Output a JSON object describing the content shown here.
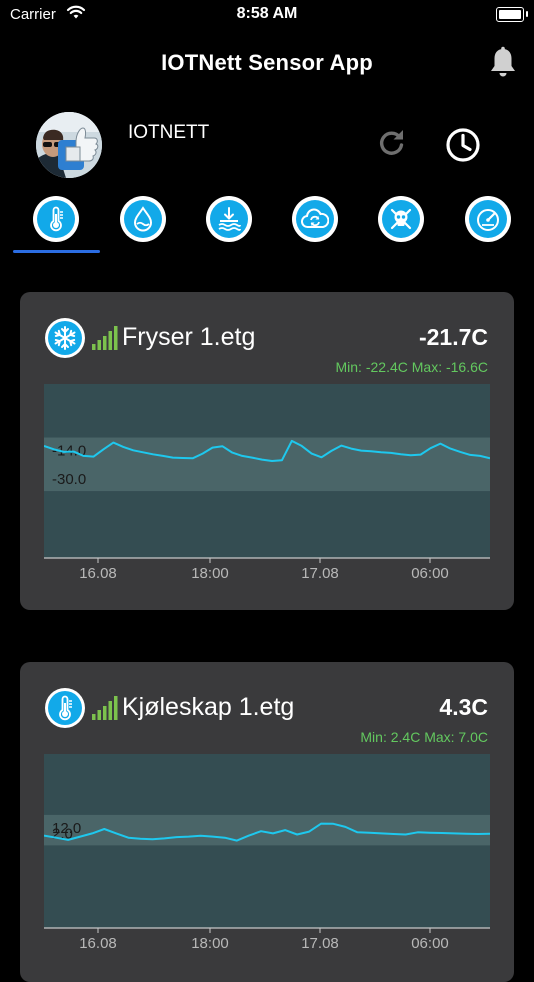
{
  "status_bar": {
    "carrier": "Carrier",
    "time": "8:58 AM"
  },
  "header": {
    "title": "IOTNett Sensor App",
    "bell_icon": "bell-icon"
  },
  "user": {
    "name": "IOTNETT",
    "refresh_icon": "refresh-icon",
    "clock_icon": "clock-icon"
  },
  "tabs": [
    {
      "icon": "thermometer-icon",
      "selected": true
    },
    {
      "icon": "humidity-drop-icon",
      "selected": false
    },
    {
      "icon": "water-level-icon",
      "selected": false
    },
    {
      "icon": "cloud-sync-icon",
      "selected": false
    },
    {
      "icon": "skull-crossbones-icon",
      "selected": false
    },
    {
      "icon": "gauge-icon",
      "selected": false
    }
  ],
  "colors": {
    "accent": "#12a9e9",
    "tab_underline": "#2b6de3",
    "minmax": "#63c85f",
    "card_bg": "#3a3a3c",
    "chart_bg": "#344d52",
    "band": "#4a6568",
    "line": "#1ec8ee"
  },
  "sensors": [
    {
      "icon": "snowflake-icon",
      "name": "Fryser 1.etg",
      "value": "-21.7C",
      "minmax": "Min: -22.4C Max: -16.6C"
    },
    {
      "icon": "thermometer-icon",
      "name": "Kjøleskap 1.etg",
      "value": "4.3C",
      "minmax": "Min: 2.4C Max: 7.0C"
    }
  ],
  "chart_data": [
    {
      "type": "line",
      "title": "",
      "threshold_labels": [
        "-14.0",
        "-30.0"
      ],
      "band": [
        -30.0,
        -14.0
      ],
      "ylim": [
        -50,
        2
      ],
      "x_ticks": [
        "16.08",
        "18:00",
        "17.08",
        "06:00"
      ],
      "series": [
        {
          "values": [
            -16.5,
            -17.5,
            -18.3,
            -18.2,
            -19.5,
            -19.7,
            -17.5,
            -15.5,
            -16.8,
            -17.8,
            -18.4,
            -19.0,
            -19.5,
            -20.0,
            -20.1,
            -20.2,
            -18.8,
            -17.0,
            -16.6,
            -18.5,
            -19.5,
            -20.0,
            -20.6,
            -21.0,
            -20.8,
            -15.0,
            -16.5,
            -18.8,
            -19.9,
            -18.0,
            -16.4,
            -17.3,
            -17.9,
            -18.1,
            -18.4,
            -18.6,
            -19.0,
            -19.3,
            -19.1,
            -17.2,
            -15.8,
            -17.3,
            -18.3,
            -19.2,
            -19.5,
            -20.2
          ]
        }
      ]
    },
    {
      "type": "line",
      "title": "",
      "threshold_labels": [
        "12.0",
        "2.0"
      ],
      "band": [
        -2.0,
        12.0
      ],
      "ylim": [
        -40,
        40
      ],
      "x_ticks": [
        "16.08",
        "18:00",
        "17.08",
        "06:00"
      ],
      "series": [
        {
          "values": [
            2.5,
            1.5,
            0.5,
            2.0,
            3.5,
            5.5,
            3.5,
            1.5,
            1.0,
            0.8,
            1.2,
            1.8,
            2.0,
            2.4,
            2.0,
            1.5,
            0.2,
            2.5,
            4.5,
            3.5,
            5.0,
            3.0,
            4.3,
            8.0,
            7.9,
            6.5,
            4.0,
            3.8,
            3.5,
            3.2,
            3.0,
            4.0,
            3.8,
            3.7,
            3.5,
            3.3,
            3.2,
            3.3
          ]
        }
      ]
    }
  ]
}
